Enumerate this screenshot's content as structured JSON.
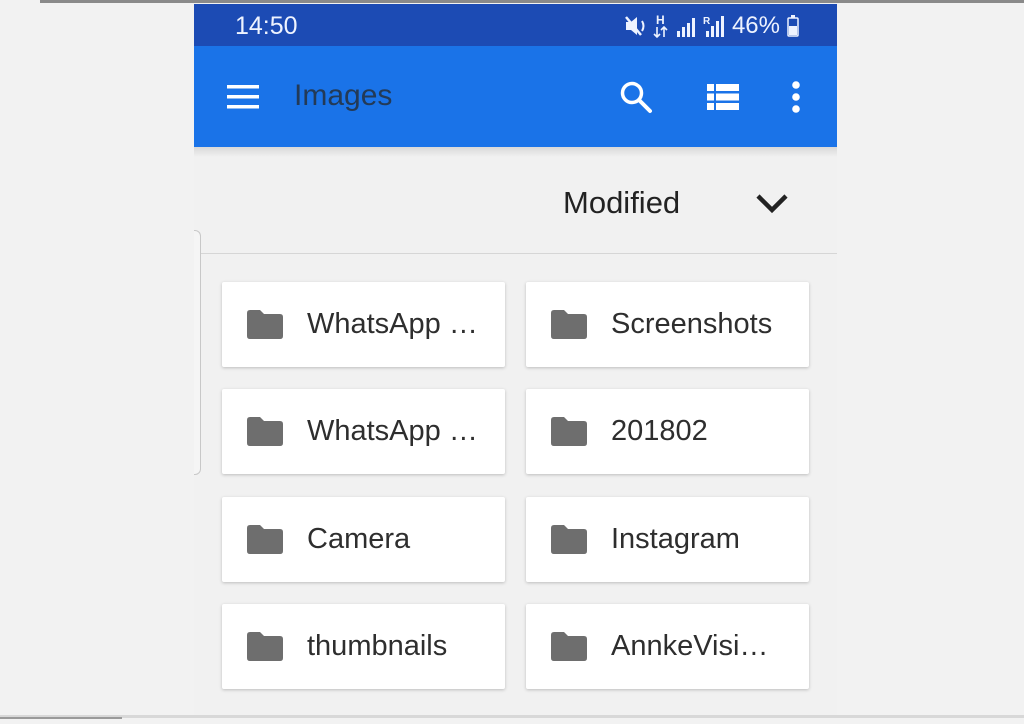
{
  "status_bar": {
    "time": "14:50",
    "battery": "46%",
    "icons": [
      "mute-vibrate-icon",
      "data-h-icon",
      "signal-icon",
      "roaming-signal-icon",
      "battery-icon"
    ]
  },
  "toolbar": {
    "title": "Images",
    "menu_icon": "hamburger-menu-icon",
    "search_icon": "search-icon",
    "view_icon": "list-view-icon",
    "more_icon": "more-vert-icon",
    "background": "#1a73e8",
    "status_background": "#1c4bb4"
  },
  "sort": {
    "label": "Modified",
    "icon": "chevron-down-icon"
  },
  "folders": [
    {
      "name": "WhatsApp …"
    },
    {
      "name": "Screenshots"
    },
    {
      "name": "WhatsApp …"
    },
    {
      "name": "201802"
    },
    {
      "name": "Camera"
    },
    {
      "name": "Instagram"
    },
    {
      "name": "thumbnails"
    },
    {
      "name": "AnnkeVisi…"
    }
  ]
}
